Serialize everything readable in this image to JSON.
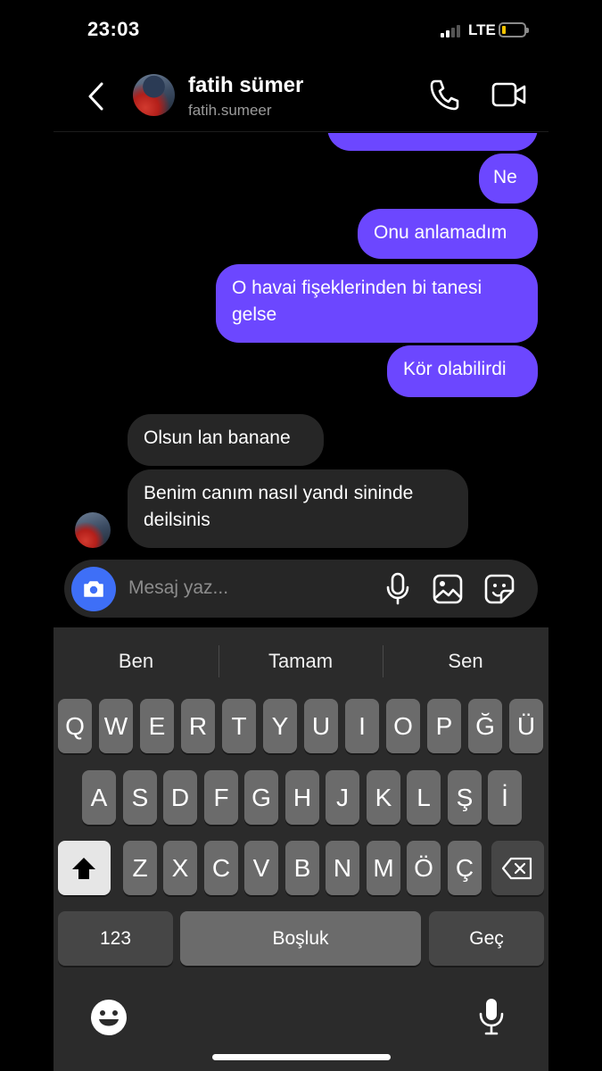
{
  "status_bar": {
    "time": "23:03",
    "network": "LTE",
    "battery_level": 0.12,
    "battery_color": "#f5c400"
  },
  "header": {
    "name": "fatih sümer",
    "username": "fatih.sumeer",
    "icons": [
      "chevron-left-icon",
      "phone-icon",
      "video-camera-icon"
    ]
  },
  "messages": [
    {
      "from": "me",
      "text": "Ne"
    },
    {
      "from": "me",
      "text": "Onu anlamadım"
    },
    {
      "from": "me",
      "text": "O havai fişeklerinden bi tanesi gelse"
    },
    {
      "from": "me",
      "text": "Kör olabilirdi"
    },
    {
      "from": "them",
      "text": "Olsun lan banane"
    },
    {
      "from": "them",
      "text": "Benim canım nasıl yandı sininde deilsinis"
    }
  ],
  "composer": {
    "placeholder": "Mesaj yaz..."
  },
  "keyboard": {
    "suggestions": [
      "Ben",
      "Tamam",
      "Sen"
    ],
    "row1": [
      "Q",
      "W",
      "E",
      "R",
      "T",
      "Y",
      "U",
      "I",
      "O",
      "P",
      "Ğ",
      "Ü"
    ],
    "row2": [
      "A",
      "S",
      "D",
      "F",
      "G",
      "H",
      "J",
      "K",
      "L",
      "Ş",
      "İ"
    ],
    "row3": [
      "Z",
      "X",
      "C",
      "V",
      "B",
      "N",
      "M",
      "Ö",
      "Ç"
    ],
    "numbers_key": "123",
    "space_key": "Boşluk",
    "return_key": "Geç"
  },
  "colors": {
    "sent_bubble": "#6c47ff",
    "received_bubble": "#262626",
    "camera_button": "#3e6ff7"
  }
}
